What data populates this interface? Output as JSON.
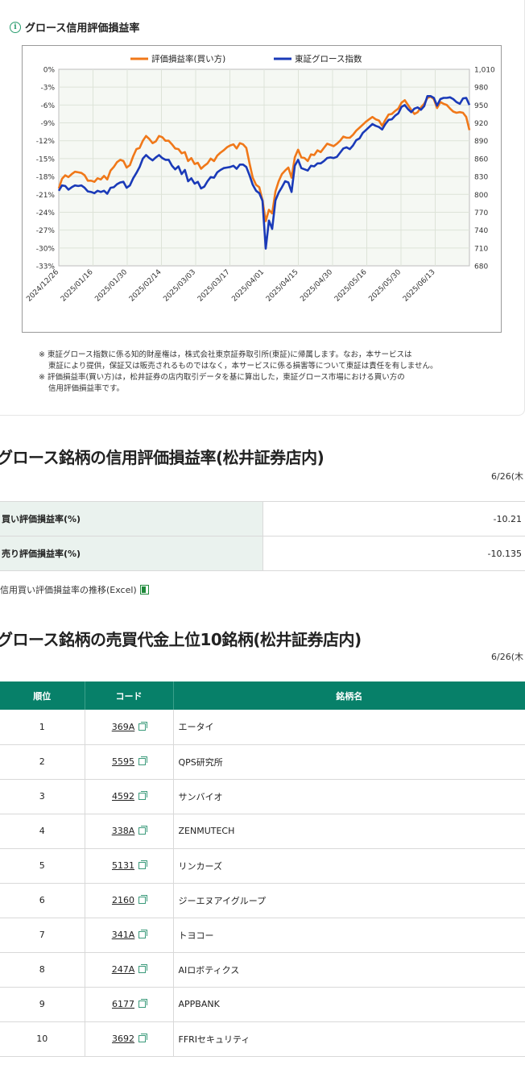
{
  "panel": {
    "title": "グロース信用評価損益率",
    "info_icon": "info-icon"
  },
  "chart_data": {
    "type": "line",
    "legend": [
      "評価損益率(買い方)",
      "東証グロース指数"
    ],
    "legend_position": "top",
    "colors": {
      "buy_ratio": "#f07819",
      "index": "#1a3ab8"
    },
    "left_axis": {
      "ticks": [
        "0%",
        "-3%",
        "-6%",
        "-9%",
        "-12%",
        "-15%",
        "-18%",
        "-21%",
        "-24%",
        "-27%",
        "-30%",
        "-33%"
      ],
      "range": [
        -33,
        0
      ]
    },
    "right_axis": {
      "ticks": [
        "1,010",
        "980",
        "950",
        "920",
        "890",
        "860",
        "830",
        "800",
        "770",
        "740",
        "710",
        "680"
      ],
      "range": [
        680,
        1010
      ]
    },
    "x_ticks": [
      "2024/12/26",
      "2025/01/16",
      "2025/01/30",
      "2025/02/14",
      "2025/03/03",
      "2025/03/17",
      "2025/04/01",
      "2025/04/15",
      "2025/04/30",
      "2025/05/16",
      "2025/05/30",
      "2025/06/13"
    ],
    "grid": true,
    "series": [
      {
        "name": "評価損益率(買い方)",
        "axis": "left",
        "values": [
          -20.0,
          -18.4,
          -17.8,
          -18.1,
          -17.6,
          -17.2,
          -17.3,
          -17.4,
          -17.8,
          -18.7,
          -18.7,
          -18.9,
          -18.3,
          -18.5,
          -17.9,
          -18.5,
          -17.0,
          -16.4,
          -15.6,
          -15.2,
          -15.4,
          -16.5,
          -16.1,
          -14.6,
          -13.4,
          -13.2,
          -12.0,
          -11.2,
          -11.7,
          -12.4,
          -12.1,
          -11.2,
          -11.4,
          -12.0,
          -12.0,
          -12.6,
          -13.3,
          -13.4,
          -14.1,
          -13.9,
          -15.4,
          -14.9,
          -15.9,
          -15.7,
          -16.7,
          -16.2,
          -15.8,
          -15.0,
          -15.4,
          -14.5,
          -14.0,
          -13.6,
          -13.1,
          -12.8,
          -12.6,
          -13.3,
          -12.4,
          -12.6,
          -13.2,
          -15.8,
          -18.2,
          -19.4,
          -19.8,
          -22.0,
          -25.5,
          -23.6,
          -24.2,
          -20.5,
          -18.8,
          -17.6,
          -17.0,
          -16.5,
          -18.2,
          -14.8,
          -13.5,
          -14.8,
          -14.9,
          -15.4,
          -14.3,
          -14.4,
          -13.6,
          -13.9,
          -13.2,
          -12.5,
          -12.7,
          -12.9,
          -12.5,
          -12.0,
          -11.3,
          -11.5,
          -11.5,
          -11.0,
          -10.3,
          -9.8,
          -9.3,
          -8.8,
          -8.4,
          -8.0,
          -8.4,
          -8.6,
          -9.5,
          -8.5,
          -7.6,
          -7.5,
          -7.0,
          -6.6,
          -5.6,
          -5.2,
          -6.0,
          -6.8,
          -7.5,
          -7.2,
          -6.4,
          -5.8,
          -4.8,
          -4.6,
          -5.0,
          -6.5,
          -5.5,
          -5.8,
          -6.0,
          -6.6,
          -7.1,
          -7.3,
          -7.2,
          -7.3,
          -8.0,
          -10.21
        ]
      },
      {
        "name": "東証グロース指数",
        "axis": "right",
        "values": [
          806,
          815,
          814,
          808,
          812,
          815,
          814,
          815,
          811,
          805,
          804,
          802,
          806,
          804,
          806,
          801,
          811,
          812,
          817,
          820,
          821,
          811,
          815,
          827,
          836,
          846,
          860,
          866,
          861,
          857,
          862,
          866,
          861,
          858,
          858,
          848,
          842,
          847,
          834,
          841,
          822,
          827,
          818,
          821,
          810,
          813,
          822,
          829,
          828,
          837,
          841,
          844,
          845,
          846,
          848,
          843,
          850,
          850,
          846,
          832,
          816,
          806,
          802,
          789,
          709,
          756,
          742,
          790,
          803,
          812,
          822,
          820,
          804,
          848,
          858,
          844,
          842,
          840,
          848,
          847,
          852,
          852,
          856,
          861,
          862,
          861,
          863,
          870,
          877,
          879,
          876,
          882,
          891,
          894,
          903,
          908,
          913,
          918,
          915,
          913,
          909,
          918,
          925,
          926,
          932,
          936,
          947,
          950,
          943,
          938,
          944,
          946,
          942,
          948,
          965,
          965,
          962,
          949,
          960,
          962,
          962,
          963,
          960,
          955,
          952,
          961,
          962,
          950
        ]
      }
    ]
  },
  "notes": [
    "※ 東証グロース指数に係る知的財産権は，株式会社東京証券取引所(東証)に帰属します。なお，本サービスは",
    "東証により提供，保証又は販売されるものではなく，本サービスに係る損害等について東証は責任を有しません。",
    "※ 評価損益率(買い方)は，松井証券の店内取引データを基に算出した，東証グロース市場における買い方の",
    "信用評価損益率です。"
  ],
  "section1": {
    "title": "グロース銘柄の信用評価損益率(松井証券店内)",
    "date": "6/26(木"
  },
  "pl_table": [
    {
      "label": "買い評価損益率(%)",
      "value": "-10.21"
    },
    {
      "label": "売り評価損益率(%)",
      "value": "-10.135"
    }
  ],
  "excel_link": {
    "label": "信用買い評価損益率の推移(Excel)",
    "icon": "excel-icon"
  },
  "section2": {
    "title": "グロース銘柄の売買代金上位10銘柄(松井証券店内)",
    "date": "6/26(木"
  },
  "ranking": {
    "headers": [
      "順位",
      "コード",
      "銘柄名"
    ],
    "rows": [
      {
        "rank": "1",
        "code": "369A",
        "name": "エータイ"
      },
      {
        "rank": "2",
        "code": "5595",
        "name": "QPS研究所"
      },
      {
        "rank": "3",
        "code": "4592",
        "name": "サンバイオ"
      },
      {
        "rank": "4",
        "code": "338A",
        "name": "ZENMUTECH"
      },
      {
        "rank": "5",
        "code": "5131",
        "name": "リンカーズ"
      },
      {
        "rank": "6",
        "code": "2160",
        "name": "ジーエヌアイグループ"
      },
      {
        "rank": "7",
        "code": "341A",
        "name": "トヨコー"
      },
      {
        "rank": "8",
        "code": "247A",
        "name": "AIロボティクス"
      },
      {
        "rank": "9",
        "code": "6177",
        "name": "APPBANK"
      },
      {
        "rank": "10",
        "code": "3692",
        "name": "FFRIセキュリティ"
      }
    ],
    "copy_icon": "copy-icon"
  }
}
